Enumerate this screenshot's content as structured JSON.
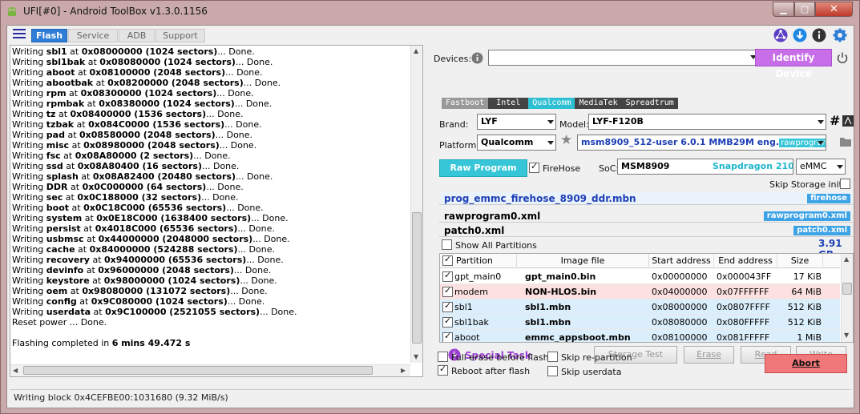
{
  "window": {
    "title": "UFI[#0] - Android ToolBox v1.3.0.1156",
    "min": "▁",
    "max": "▢",
    "close": "✕"
  },
  "tabs": [
    "Flash",
    "Service",
    "ADB",
    "Support"
  ],
  "log": [
    [
      "Writing ",
      "sbl1",
      " at ",
      "0x08000000 (1024 sectors)",
      "... Done."
    ],
    [
      "Writing ",
      "sbl1bak",
      " at ",
      "0x08080000 (1024 sectors)",
      "... Done."
    ],
    [
      "Writing ",
      "aboot",
      " at ",
      "0x08100000 (2048 sectors)",
      "... Done."
    ],
    [
      "Writing ",
      "abootbak",
      " at ",
      "0x08200000 (2048 sectors)",
      "... Done."
    ],
    [
      "Writing ",
      "rpm",
      " at ",
      "0x08300000 (1024 sectors)",
      "... Done."
    ],
    [
      "Writing ",
      "rpmbak",
      " at ",
      "0x08380000 (1024 sectors)",
      "... Done."
    ],
    [
      "Writing ",
      "tz",
      " at ",
      "0x08400000 (1536 sectors)",
      "... Done."
    ],
    [
      "Writing ",
      "tzbak",
      " at ",
      "0x084C0000 (1536 sectors)",
      "... Done."
    ],
    [
      "Writing ",
      "pad",
      " at ",
      "0x08580000 (2048 sectors)",
      "... Done."
    ],
    [
      "Writing ",
      "misc",
      " at ",
      "0x08980000 (2048 sectors)",
      "... Done."
    ],
    [
      "Writing ",
      "fsc",
      " at ",
      "0x08A80000 (2 sectors)",
      "... Done."
    ],
    [
      "Writing ",
      "ssd",
      " at ",
      "0x08A80400 (16 sectors)",
      "... Done."
    ],
    [
      "Writing ",
      "splash",
      " at ",
      "0x08A82400 (20480 sectors)",
      "... Done."
    ],
    [
      "Writing ",
      "DDR",
      " at ",
      "0x0C000000 (64 sectors)",
      "... Done."
    ],
    [
      "Writing ",
      "sec",
      " at ",
      "0x0C188000 (32 sectors)",
      "... Done."
    ],
    [
      "Writing ",
      "boot",
      " at ",
      "0x0C18C000 (65536 sectors)",
      "... Done."
    ],
    [
      "Writing ",
      "system",
      " at ",
      "0x0E18C000 (1638400 sectors)",
      "... Done."
    ],
    [
      "Writing ",
      "persist",
      " at ",
      "0x4018C000 (65536 sectors)",
      "... Done."
    ],
    [
      "Writing ",
      "usbmsc",
      " at ",
      "0x44000000 (2048000 sectors)",
      "... Done."
    ],
    [
      "Writing ",
      "cache",
      " at ",
      "0x84000000 (524288 sectors)",
      "... Done."
    ],
    [
      "Writing ",
      "recovery",
      " at ",
      "0x94000000 (65536 sectors)",
      "... Done."
    ],
    [
      "Writing ",
      "devinfo",
      " at ",
      "0x96000000 (2048 sectors)",
      "... Done."
    ],
    [
      "Writing ",
      "keystore",
      " at ",
      "0x98000000 (1024 sectors)",
      "... Done."
    ],
    [
      "Writing ",
      "oem",
      " at ",
      "0x98080000 (131072 sectors)",
      "... Done."
    ],
    [
      "Writing ",
      "config",
      " at ",
      "0x9C080000 (1024 sectors)",
      "... Done."
    ],
    [
      "Writing ",
      "userdata",
      " at ",
      "0x9C100000 (2521055 sectors)",
      "... Done."
    ],
    [
      "Reset power ... Done.",
      "",
      "",
      "",
      ""
    ],
    [
      "",
      "",
      "",
      "",
      ""
    ],
    [
      "Flashing completed in ",
      "6 mins 49.472 s",
      "",
      "",
      ""
    ]
  ],
  "status": "Writing block 0x4CEFBE00:1031680 (9.32 MiB/s)",
  "devices": {
    "label": "Devices:",
    "value": "",
    "identify": "Identify Device"
  },
  "chips": [
    "Fastboot",
    "Intel",
    "Qualcomm",
    "MediaTek",
    "Spreadtrum"
  ],
  "brand": {
    "label": "Brand:",
    "value": "LYF"
  },
  "model": {
    "label": "Model:",
    "value": "LYF-F120B"
  },
  "platform": {
    "label": "Platform:",
    "value": "Qualcomm"
  },
  "firmware": {
    "value": "msm8909_512-user 6.0.1 MMB29M eng.",
    "tag": "rawprogram0"
  },
  "rawprogram_btn": "Raw Program",
  "firehose_label": "FireHose",
  "soc": {
    "label": "SoC:",
    "value": "MSM8909",
    "chip": "Snapdragon 210",
    "storage": "eMMC"
  },
  "skip_storage_init": "Skip Storage init",
  "files": [
    {
      "name": "prog_emmc_firehose_8909_ddr.mbn",
      "badge": "firehose"
    },
    {
      "name": "rawprogram0.xml",
      "badge": "rawprogram0.xml"
    },
    {
      "name": "patch0.xml",
      "badge": "patch0.xml"
    }
  ],
  "show_all": "Show All Partitions",
  "capacity": "3.91 GB",
  "table": {
    "headers": [
      "Partition",
      "Image file",
      "Start address",
      "End address",
      "Size"
    ],
    "rows": [
      [
        "gpt_main0",
        "gpt_main0.bin",
        "0x00000000",
        "0x000043FF",
        "17 KiB"
      ],
      [
        "modem",
        "NON-HLOS.bin",
        "0x04000000",
        "0x07FFFFFF",
        "64 MiB"
      ],
      [
        "sbl1",
        "sbl1.mbn",
        "0x08000000",
        "0x0807FFFF",
        "512 KiB"
      ],
      [
        "sbl1bak",
        "sbl1.mbn",
        "0x08080000",
        "0x080FFFFF",
        "512 KiB"
      ],
      [
        "aboot",
        "emmc_appsboot.mbn",
        "0x08100000",
        "0x081FFFFF",
        "1 MiB"
      ]
    ]
  },
  "special_task": "Special Task",
  "actions": [
    "Storage Test",
    "Erase",
    "Read",
    "Write"
  ],
  "options": {
    "full_erase": "Full erase before flash",
    "reboot": "Reboot after flash",
    "skip_repartition": "Skip re-partition",
    "skip_userdata": "Skip userdata"
  },
  "abort": "Abort",
  "colors": {
    "accent": "#2f7dd6",
    "purple": "#c76ee8",
    "cyan": "#36c6d8",
    "abort": "#f0787a",
    "modem_row": "#fde0e0",
    "blue_row": "#dbeefb"
  }
}
